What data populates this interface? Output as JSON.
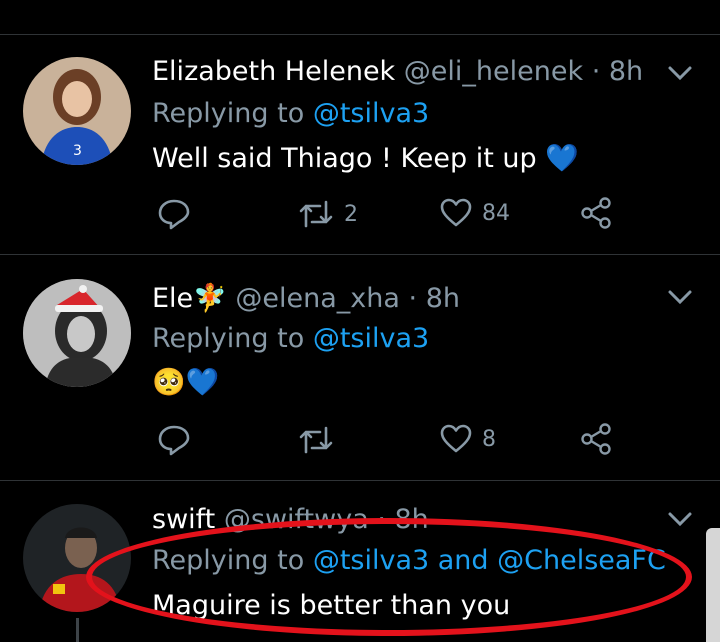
{
  "tweets": [
    {
      "name": "Elizabeth Helenek",
      "handle": "@eli_helenek",
      "time": "· 8h",
      "replying_prefix": "Replying to ",
      "mentions": "@tsilva3",
      "body": "Well said Thiago ! Keep it up",
      "body_emoji": "💙",
      "retweets": "2",
      "likes": "84"
    },
    {
      "name": "Ele",
      "name_emoji": "🧚",
      "handle": "@elena_xha",
      "time": "· 8h",
      "replying_prefix": "Replying to ",
      "mentions": "@tsilva3",
      "body": "🥺💙",
      "retweets": "",
      "likes": "8"
    },
    {
      "name": "swift",
      "handle": "@swiftwya",
      "time": "· 8h",
      "replying_prefix": "Replying to ",
      "mentions": "@tsilva3 and @ChelseaFC",
      "body": "Maguire is better than you"
    }
  ],
  "colors": {
    "background": "#000000",
    "accent": "#1da1f2",
    "muted": "#8899a6",
    "annotation": "#e3121b"
  },
  "icons": [
    "reply-icon",
    "retweet-icon",
    "like-icon",
    "share-icon",
    "chevron-down-icon"
  ]
}
